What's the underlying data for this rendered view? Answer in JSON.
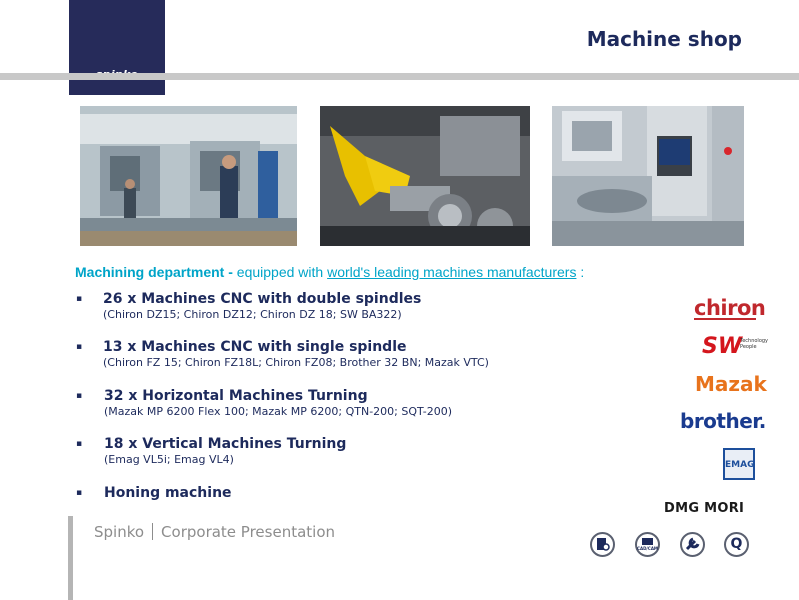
{
  "header": {
    "logo_text": "-spinko-",
    "title": "Machine shop"
  },
  "intro": {
    "dept_label": "Machining department -",
    "equipped_text": "equipped with",
    "link_text": "world's leading machines manufacturers",
    "suffix": ":"
  },
  "items": [
    {
      "heading": "26 x Machines CNC with double spindles",
      "detail": "(Chiron DZ15; Chiron DZ12; Chiron DZ 18; SW BA322)"
    },
    {
      "heading": "13 x Machines CNC with single spindle",
      "detail": "(Chiron FZ 15; Chiron FZ18L; Chiron FZ08; Brother 32 BN; Mazak VTC)"
    },
    {
      "heading": "32 x Horizontal Machines Turning",
      "detail": "(Mazak MP 6200 Flex 100; Mazak MP 6200; QTN-200; SQT-200)"
    },
    {
      "heading": "18 x Vertical Machines Turning",
      "detail": "(Emag VL5i;  Emag VL4)"
    },
    {
      "heading": "Honing machine",
      "detail": ""
    }
  ],
  "bullet_char": "▪",
  "brands": {
    "chiron": "chiron",
    "sw": "SW",
    "sw_sub": "Technology People",
    "mazak": "Mazak",
    "brother": "brother.",
    "emag": "EMAG",
    "dmg": "DMG MORI"
  },
  "brand_colors": {
    "chiron": "#c0282d",
    "sw": "#d4161d",
    "mazak": "#e8731c",
    "brother": "#1a3b8f",
    "emag": "#1d4f9c",
    "dmg": "#1a1a1a"
  },
  "footer": {
    "company": "Spinko",
    "subtitle": "Corporate Presentation"
  },
  "footer_icons": [
    {
      "label": "",
      "icon": "document-gear-icon"
    },
    {
      "label": "CAD/CAM",
      "icon": "cad-cam-icon"
    },
    {
      "label": "",
      "icon": "wrench-icon"
    },
    {
      "label": "Q",
      "icon": "quality-icon"
    }
  ],
  "photos": [
    "factory-floor-photo",
    "robot-arm-photo",
    "cnc-machine-photo"
  ]
}
